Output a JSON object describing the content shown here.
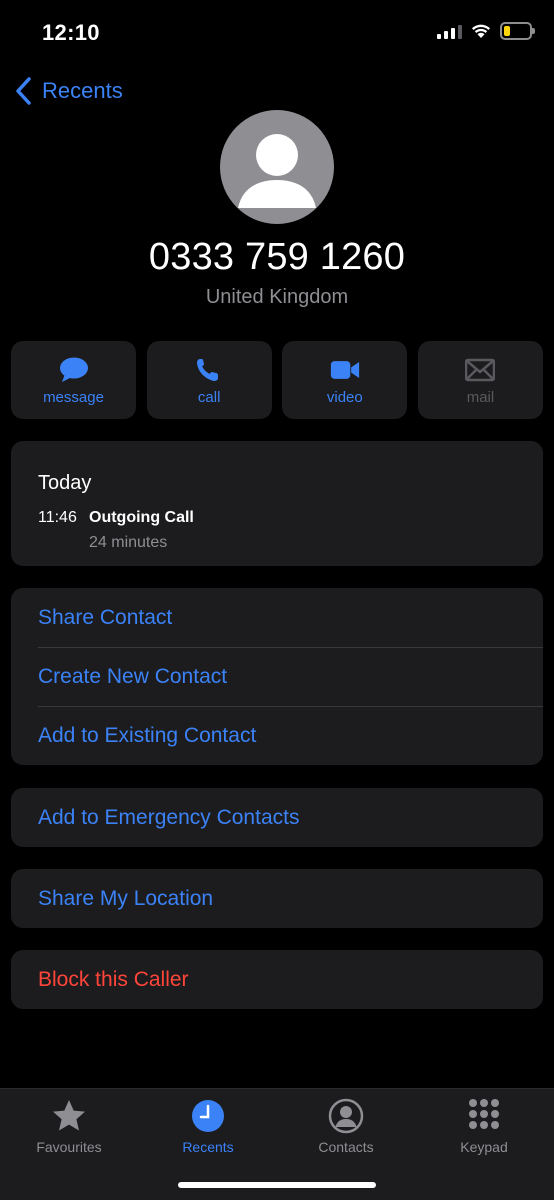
{
  "status_bar": {
    "time": "12:10",
    "battery_level": 0.25,
    "battery_color": "#ffd60a"
  },
  "nav": {
    "back_label": "Recents",
    "back_icon": "chevron-left-icon"
  },
  "caller": {
    "number": "0333 759 1260",
    "country": "United Kingdom",
    "avatar_icon": "person-silhouette-icon"
  },
  "actions": [
    {
      "label": "message",
      "icon": "message-bubble-icon",
      "enabled": true
    },
    {
      "label": "call",
      "icon": "phone-icon",
      "enabled": true
    },
    {
      "label": "video",
      "icon": "video-camera-icon",
      "enabled": true
    },
    {
      "label": "mail",
      "icon": "envelope-icon",
      "enabled": false
    }
  ],
  "history": {
    "day": "Today",
    "entries": [
      {
        "time": "11:46",
        "type": "Outgoing Call",
        "duration": "24 minutes"
      }
    ]
  },
  "menu": {
    "share_contact": "Share Contact",
    "create_new_contact": "Create New Contact",
    "add_to_existing": "Add to Existing Contact",
    "add_to_emergency": "Add to Emergency Contacts",
    "share_location": "Share My Location",
    "block_caller": "Block this Caller"
  },
  "tab_bar": {
    "tabs": [
      {
        "label": "Favourites",
        "icon": "star-icon",
        "active": false
      },
      {
        "label": "Recents",
        "icon": "clock-icon",
        "active": true
      },
      {
        "label": "Contacts",
        "icon": "person-circle-icon",
        "active": false
      },
      {
        "label": "Keypad",
        "icon": "keypad-icon",
        "active": false
      }
    ]
  },
  "colors": {
    "accent": "#3b82f6",
    "danger": "#ff453a",
    "card_background": "#1c1c1e",
    "secondary_text": "#8e8e93"
  }
}
